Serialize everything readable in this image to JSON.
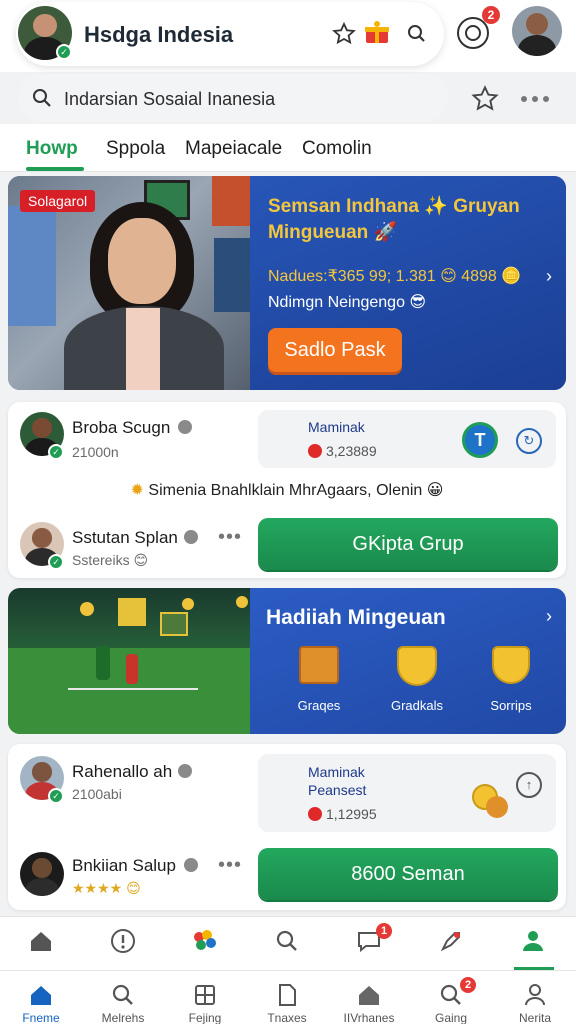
{
  "header": {
    "title": "Hsdga Indesia",
    "notification_count": "2",
    "icons": [
      "star-add-icon",
      "gift-icon",
      "person-icon",
      "target-icon"
    ]
  },
  "search": {
    "value": "Indarsian Sosaial Inanesia"
  },
  "tabs": [
    {
      "label": "Howp",
      "active": true
    },
    {
      "label": "Sppola",
      "active": false
    },
    {
      "label": "Mapeiacale",
      "active": false
    },
    {
      "label": "Comolin",
      "active": false
    }
  ],
  "banner": {
    "tag": "Solagarol",
    "title": "Semsan Indhana ✨ Gruyan Mingueuan 🚀",
    "stats": "Nadues:₹365 99; 1.381 😊 4898 🪙",
    "subtitle": "Ndimgn Neingengo 😎",
    "cta": "Sadlo Pask"
  },
  "card1": {
    "user1": {
      "name": "Broba Scugn",
      "meta": "21000n"
    },
    "info": {
      "label": "Maminak",
      "value": "3,23889"
    },
    "announcement": "Simenia Bnahlklain MhrAgaars, Olenin 😀",
    "user2": {
      "name": "Sstutan Splan",
      "meta": "Sstereiks 😊"
    },
    "button": "GKipta Grup"
  },
  "rewards": {
    "title": "Hadiiah Mingeuan",
    "items": [
      {
        "label": "Graqes"
      },
      {
        "label": "Gradkals"
      },
      {
        "label": "Sorrips"
      }
    ]
  },
  "card2": {
    "user1": {
      "name": "Rahenallo ah",
      "meta": "2100abi"
    },
    "info": {
      "label": "Maminak",
      "label2": "Peansest",
      "value": "1,12995"
    },
    "user2": {
      "name": "Bnkiian Salup",
      "meta": "★★★★ 😊"
    },
    "button": "8600 Seman"
  },
  "nav_upper": {
    "messages_badge": "1",
    "icons": [
      "home-icon",
      "alert-icon",
      "apps-icon",
      "search-icon",
      "chat-icon",
      "rocket-icon",
      "profile-icon"
    ]
  },
  "nav_lower": [
    {
      "label": "Fneme",
      "active": true
    },
    {
      "label": "Melrehs",
      "active": false
    },
    {
      "label": "Fejing",
      "active": false
    },
    {
      "label": "Tnaxes",
      "active": false
    },
    {
      "label": "IIVrhanes",
      "active": false
    },
    {
      "label": "Gaing",
      "active": false,
      "badge": "2"
    },
    {
      "label": "Nerita",
      "active": false
    }
  ],
  "colors": {
    "accent_green": "#1f9d55",
    "banner_blue": "#1e4da8",
    "banner_gold": "#f4c63d",
    "cta_orange": "#f4731e",
    "badge_red": "#e53935",
    "nav_active_blue": "#1565c0"
  }
}
